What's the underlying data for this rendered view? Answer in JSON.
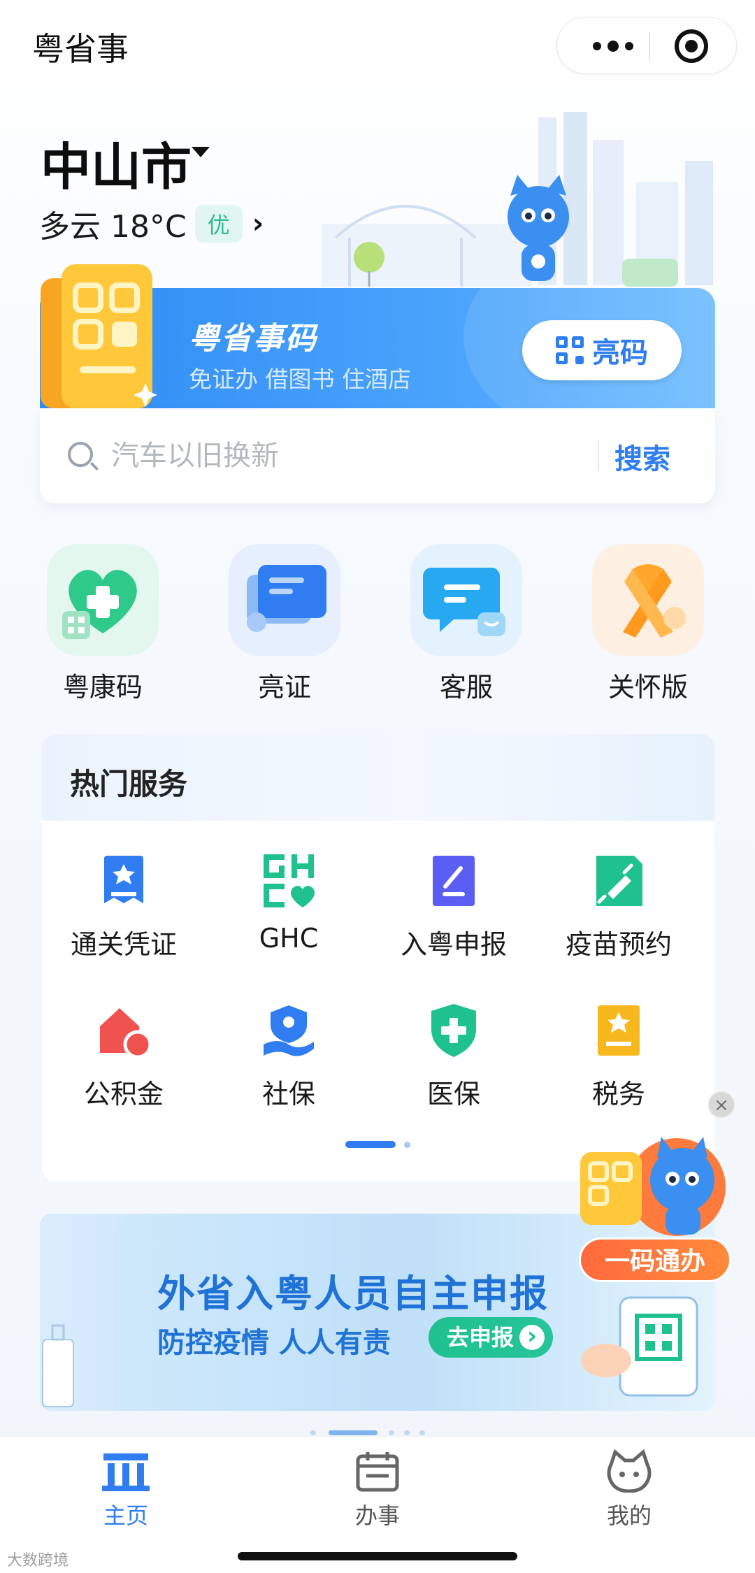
{
  "app": {
    "title": "粤省事"
  },
  "capsule": {
    "more_icon": "more-icon",
    "close_icon": "target-icon"
  },
  "location": {
    "city": "中山市",
    "weather": "多云 18°C",
    "aqi": "优"
  },
  "code_banner": {
    "title": "粤省事码",
    "subtitle": "免证办 借图书 住酒店",
    "button": "亮码"
  },
  "search": {
    "placeholder": "汽车以旧换新",
    "button": "搜索"
  },
  "quick_entries": [
    {
      "label": "粤康码",
      "icon": "health-code-heart-icon"
    },
    {
      "label": "亮证",
      "icon": "id-cards-icon"
    },
    {
      "label": "客服",
      "icon": "chat-bubble-icon"
    },
    {
      "label": "关怀版",
      "icon": "ribbon-icon"
    }
  ],
  "hot_services": {
    "title": "热门服务",
    "items": [
      {
        "label": "通关凭证",
        "icon": "customs-pass-icon"
      },
      {
        "label": "GHC",
        "icon": "ghc-icon"
      },
      {
        "label": "入粤申报",
        "icon": "declare-icon"
      },
      {
        "label": "疫苗预约",
        "icon": "vaccine-icon"
      },
      {
        "label": "公积金",
        "icon": "housing-fund-icon"
      },
      {
        "label": "社保",
        "icon": "social-insurance-icon"
      },
      {
        "label": "医保",
        "icon": "medical-insurance-icon"
      },
      {
        "label": "税务",
        "icon": "tax-icon"
      }
    ]
  },
  "floating": {
    "label": "一码通办",
    "close": "×"
  },
  "ad": {
    "title": "外省入粤人员自主申报",
    "subtitle": "防控疫情 人人有责",
    "button": "去申报"
  },
  "tabs": [
    {
      "label": "主页",
      "active": true,
      "icon": "home-icon"
    },
    {
      "label": "办事",
      "active": false,
      "icon": "calendar-icon"
    },
    {
      "label": "我的",
      "active": false,
      "icon": "profile-icon"
    }
  ],
  "watermark": "大数跨境",
  "colors": {
    "accent": "#2f7df0",
    "banner": "#3a95f7",
    "green": "#1fc18f",
    "orange": "#ff8a3a"
  }
}
